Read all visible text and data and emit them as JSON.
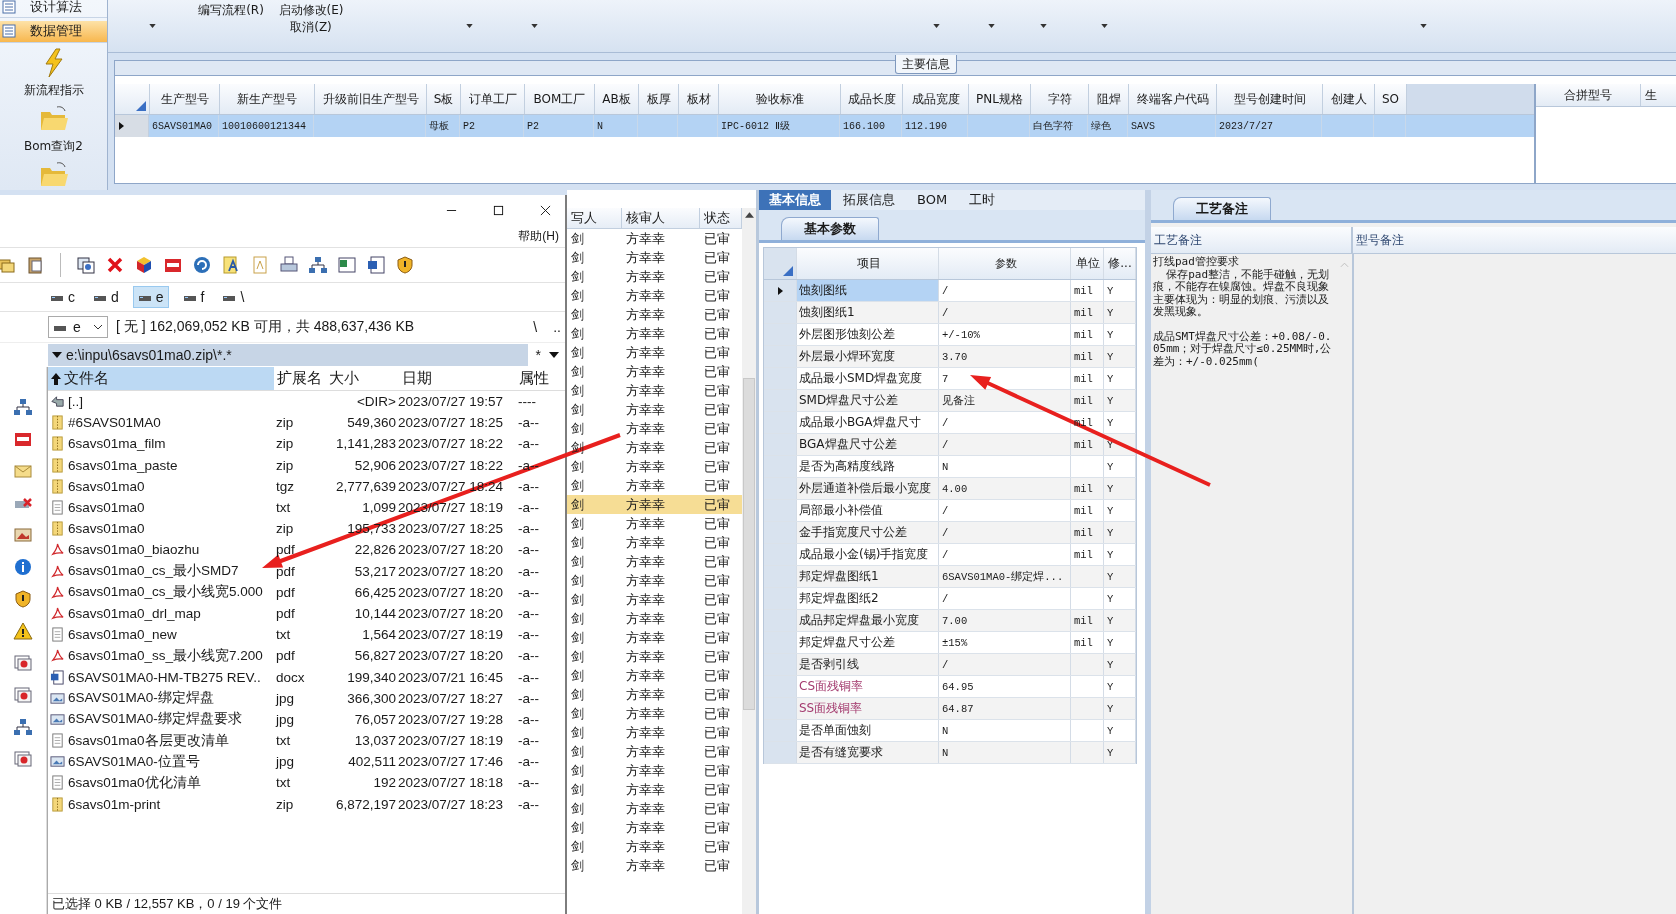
{
  "sidebar": {
    "items": [
      {
        "label": "设计算法",
        "kind": "menu",
        "selected": false
      },
      {
        "label": "数据管理",
        "kind": "menu",
        "selected": true
      },
      {
        "label": "新流程指示",
        "kind": "bolt",
        "selected": false
      },
      {
        "label": "Bom查询2",
        "kind": "folder",
        "selected": false
      },
      {
        "kind": "folder",
        "selected": false
      }
    ]
  },
  "ribbon": {
    "buttons": [
      {
        "label": "编写流程(R)"
      },
      {
        "label": "启动修改(E)"
      },
      {
        "label": "取消(Z)"
      }
    ]
  },
  "main_info": {
    "title": "主要信息",
    "columns": [
      "生产型号",
      "新生产型号",
      "升级前旧生产型号",
      "S板",
      "订单工厂",
      "BOM工厂",
      "AB板",
      "板厚",
      "板材",
      "验收标准",
      "成品长度",
      "成品宽度",
      "PNL规格",
      "字符",
      "阻焊",
      "终端客户代码",
      "型号创建时间",
      "创建人",
      "SO"
    ],
    "rows": [
      {
        "selected": true,
        "cells": [
          "6SAVS01MA0",
          "10010600121344",
          null,
          "母板",
          "P2",
          "P2",
          "N",
          null,
          null,
          "IPC-6012 Ⅱ级",
          "166.100",
          "112.190",
          null,
          "白色字符",
          "绿色",
          "SAVS",
          "2023/7/27",
          null,
          null
        ]
      }
    ],
    "merge_table": {
      "columns": [
        "合拼型号",
        "生"
      ]
    }
  },
  "file_manager": {
    "help_menu": "帮助(H)",
    "drives": [
      {
        "label": "c",
        "selected": false
      },
      {
        "label": "d",
        "selected": false
      },
      {
        "label": "e",
        "selected": true
      },
      {
        "label": "f",
        "selected": false
      },
      {
        "label": "\\",
        "selected": false
      }
    ],
    "drive_combo": "e",
    "free_space": "[ 无 ]  162,069,052 KB 可用，共 488,637,436 KB",
    "root_button": "\\",
    "up_button": "..",
    "path": "e:\\inpu\\6savs01ma0.zip\\*.*",
    "filter_button": "*",
    "columns": [
      {
        "label": "文件名",
        "selected": true
      },
      {
        "label": "扩展名",
        "selected": false
      },
      {
        "label": "大小",
        "selected": false
      },
      {
        "label": "日期",
        "selected": false
      },
      {
        "label": "属性",
        "selected": false
      }
    ],
    "files": [
      {
        "kind": "parent",
        "name": "[..]",
        "size": "<DIR>",
        "date": "2023/07/27 19:57",
        "attr": "----"
      },
      {
        "kind": "archive",
        "name": "#6SAVS01MA0",
        "ext": "zip",
        "size": "549,360",
        "date": "2023/07/27 18:25",
        "attr": "-a--"
      },
      {
        "kind": "archive",
        "name": "6savs01ma_film",
        "ext": "zip",
        "size": "1,141,283",
        "date": "2023/07/27 18:22",
        "attr": "-a--"
      },
      {
        "kind": "archive",
        "name": "6savs01ma_paste",
        "ext": "zip",
        "size": "52,906",
        "date": "2023/07/27 18:22",
        "attr": "-a--"
      },
      {
        "kind": "archive",
        "name": "6savs01ma0",
        "ext": "tgz",
        "size": "2,777,639",
        "date": "2023/07/27 18:24",
        "attr": "-a--"
      },
      {
        "kind": "text",
        "name": "6savs01ma0",
        "ext": "txt",
        "size": "1,099",
        "date": "2023/07/27 18:19",
        "attr": "-a--"
      },
      {
        "kind": "archive",
        "name": "6savs01ma0",
        "ext": "zip",
        "size": "195,733",
        "date": "2023/07/27 18:25",
        "attr": "-a--"
      },
      {
        "kind": "pdf",
        "name": "6savs01ma0_biaozhu",
        "ext": "pdf",
        "size": "22,826",
        "date": "2023/07/27 18:20",
        "attr": "-a--"
      },
      {
        "kind": "pdf",
        "name": "6savs01ma0_cs_最小SMD7",
        "ext": "pdf",
        "size": "53,217",
        "date": "2023/07/27 18:20",
        "attr": "-a--"
      },
      {
        "kind": "pdf",
        "name": "6savs01ma0_cs_最小线宽5.000",
        "ext": "pdf",
        "size": "66,425",
        "date": "2023/07/27 18:20",
        "attr": "-a--"
      },
      {
        "kind": "pdf",
        "name": "6savs01ma0_drl_map",
        "ext": "pdf",
        "size": "10,144",
        "date": "2023/07/27 18:20",
        "attr": "-a--"
      },
      {
        "kind": "text",
        "name": "6savs01ma0_new",
        "ext": "txt",
        "size": "1,564",
        "date": "2023/07/27 18:19",
        "attr": "-a--"
      },
      {
        "kind": "pdf",
        "name": "6savs01ma0_ss_最小线宽7.200",
        "ext": "pdf",
        "size": "56,827",
        "date": "2023/07/27 18:20",
        "attr": "-a--"
      },
      {
        "kind": "word",
        "name": "6SAVS01MA0-HM-TB275 REV..",
        "ext": "docx",
        "size": "199,340",
        "date": "2023/07/21 16:45",
        "attr": "-a--"
      },
      {
        "kind": "image",
        "name": "6SAVS01MA0-绑定焊盘",
        "ext": "jpg",
        "size": "366,300",
        "date": "2023/07/27 18:27",
        "attr": "-a--"
      },
      {
        "kind": "image",
        "name": "6SAVS01MA0-绑定焊盘要求",
        "ext": "jpg",
        "size": "76,057",
        "date": "2023/07/27 19:28",
        "attr": "-a--"
      },
      {
        "kind": "text",
        "name": "6savs01ma0各层更改清单",
        "ext": "txt",
        "size": "13,037",
        "date": "2023/07/27 18:19",
        "attr": "-a--"
      },
      {
        "kind": "image",
        "name": "6SAVS01MA0-位置号",
        "ext": "jpg",
        "size": "402,511",
        "date": "2023/07/27 17:46",
        "attr": "-a--"
      },
      {
        "kind": "text",
        "name": "6savs01ma0优化清单",
        "ext": "txt",
        "size": "192",
        "date": "2023/07/27 18:18",
        "attr": "-a--"
      },
      {
        "kind": "archive",
        "name": "6savs01m-print",
        "ext": "zip",
        "size": "6,872,197",
        "date": "2023/07/27 18:23",
        "attr": "-a--"
      }
    ],
    "status": "已选择 0 KB / 12,557 KB，0 / 19 个文件"
  },
  "review_list": {
    "columns": [
      "写人",
      "核审人",
      "状态"
    ],
    "rows": [
      {
        "writer": "剑",
        "reviewer": "方幸幸",
        "status": "已审",
        "selected": false
      },
      {
        "writer": "剑",
        "reviewer": "方幸幸",
        "status": "已审",
        "selected": false
      },
      {
        "writer": "剑",
        "reviewer": "方幸幸",
        "status": "已审",
        "selected": false
      },
      {
        "writer": "剑",
        "reviewer": "方幸幸",
        "status": "已审",
        "selected": false
      },
      {
        "writer": "剑",
        "reviewer": "方幸幸",
        "status": "已审",
        "selected": false
      },
      {
        "writer": "剑",
        "reviewer": "方幸幸",
        "status": "已审",
        "selected": false
      },
      {
        "writer": "剑",
        "reviewer": "方幸幸",
        "status": "已审",
        "selected": false
      },
      {
        "writer": "剑",
        "reviewer": "方幸幸",
        "status": "已审",
        "selected": false
      },
      {
        "writer": "剑",
        "reviewer": "方幸幸",
        "status": "已审",
        "selected": false
      },
      {
        "writer": "剑",
        "reviewer": "方幸幸",
        "status": "已审",
        "selected": false
      },
      {
        "writer": "剑",
        "reviewer": "方幸幸",
        "status": "已审",
        "selected": false
      },
      {
        "writer": "剑",
        "reviewer": "方幸幸",
        "status": "已审",
        "selected": false
      },
      {
        "writer": "剑",
        "reviewer": "方幸幸",
        "status": "已审",
        "selected": false
      },
      {
        "writer": "剑",
        "reviewer": "方幸幸",
        "status": "已审",
        "selected": false
      },
      {
        "writer": "剑",
        "reviewer": "方幸幸",
        "status": "已审",
        "selected": true
      },
      {
        "writer": "剑",
        "reviewer": "方幸幸",
        "status": "已审",
        "selected": false
      },
      {
        "writer": "剑",
        "reviewer": "方幸幸",
        "status": "已审",
        "selected": false
      },
      {
        "writer": "剑",
        "reviewer": "方幸幸",
        "status": "已审",
        "selected": false
      },
      {
        "writer": "剑",
        "reviewer": "方幸幸",
        "status": "已审",
        "selected": false
      },
      {
        "writer": "剑",
        "reviewer": "方幸幸",
        "status": "已审",
        "selected": false
      },
      {
        "writer": "剑",
        "reviewer": "方幸幸",
        "status": "已审",
        "selected": false
      },
      {
        "writer": "剑",
        "reviewer": "方幸幸",
        "status": "已审",
        "selected": false
      },
      {
        "writer": "剑",
        "reviewer": "方幸幸",
        "status": "已审",
        "selected": false
      },
      {
        "writer": "剑",
        "reviewer": "方幸幸",
        "status": "已审",
        "selected": false
      },
      {
        "writer": "剑",
        "reviewer": "方幸幸",
        "status": "已审",
        "selected": false
      },
      {
        "writer": "剑",
        "reviewer": "方幸幸",
        "status": "已审",
        "selected": false
      },
      {
        "writer": "剑",
        "reviewer": "方幸幸",
        "status": "已审",
        "selected": false
      },
      {
        "writer": "剑",
        "reviewer": "方幸幸",
        "status": "已审",
        "selected": false
      },
      {
        "writer": "剑",
        "reviewer": "方幸幸",
        "status": "已审",
        "selected": false
      },
      {
        "writer": "剑",
        "reviewer": "方幸幸",
        "status": "已审",
        "selected": false
      },
      {
        "writer": "剑",
        "reviewer": "方幸幸",
        "status": "已审",
        "selected": false
      },
      {
        "writer": "剑",
        "reviewer": "方幸幸",
        "status": "已审",
        "selected": false
      },
      {
        "writer": "剑",
        "reviewer": "方幸幸",
        "status": "已审",
        "selected": false
      },
      {
        "writer": "剑",
        "reviewer": "方幸幸",
        "status": "已审",
        "selected": false
      }
    ]
  },
  "properties": {
    "tabs": [
      {
        "label": "基本信息",
        "selected": true
      },
      {
        "label": "拓展信息",
        "selected": false
      },
      {
        "label": "BOM",
        "selected": false
      },
      {
        "label": "工时",
        "selected": false
      }
    ],
    "sub_tab": "基本参数",
    "columns": [
      "项目",
      "参数",
      "单位",
      "修..."
    ],
    "rows": [
      {
        "item": "蚀刻图纸",
        "value": "/",
        "unit": "mil",
        "flag": "Y",
        "kind": "normal",
        "selected": true
      },
      {
        "item": "蚀刻图纸1",
        "value": "/",
        "unit": "mil",
        "flag": "Y",
        "kind": "normal",
        "selected": false
      },
      {
        "item": "外层图形蚀刻公差",
        "value": "+/-10%",
        "unit": "mil",
        "flag": "Y",
        "kind": "normal",
        "selected": false
      },
      {
        "item": "外层最小焊环宽度",
        "value": "3.70",
        "unit": "mil",
        "flag": "Y",
        "kind": "normal",
        "selected": false
      },
      {
        "item": "成品最小SMD焊盘宽度",
        "value": "7",
        "unit": "mil",
        "flag": "Y",
        "kind": "normal",
        "selected": false
      },
      {
        "item": "SMD焊盘尺寸公差",
        "value": "见备注",
        "unit": "mil",
        "flag": "Y",
        "kind": "normal",
        "selected": false
      },
      {
        "item": "成品最小BGA焊盘尺寸",
        "value": "/",
        "unit": "mil",
        "flag": "Y",
        "kind": "normal",
        "selected": false
      },
      {
        "item": "BGA焊盘尺寸公差",
        "value": "/",
        "unit": "mil",
        "flag": "Y",
        "kind": "normal",
        "selected": false
      },
      {
        "item": "是否为高精度线路",
        "value": "N",
        "flag": "Y",
        "kind": "normal",
        "selected": false
      },
      {
        "item": "外层通道补偿后最小宽度",
        "value": "4.00",
        "unit": "mil",
        "flag": "Y",
        "kind": "normal",
        "selected": false
      },
      {
        "item": "局部最小补偿值",
        "value": "/",
        "unit": "mil",
        "flag": "Y",
        "kind": "normal",
        "selected": false
      },
      {
        "item": "金手指宽度尺寸公差",
        "value": "/",
        "unit": "mil",
        "flag": "Y",
        "kind": "normal",
        "selected": false
      },
      {
        "item": "成品最小金(锡)手指宽度",
        "value": "/",
        "unit": "mil",
        "flag": "Y",
        "kind": "normal",
        "selected": false
      },
      {
        "item": "邦定焊盘图纸1",
        "value": "6SAVS01MA0-绑定焊...",
        "flag": "Y",
        "kind": "normal",
        "selected": false
      },
      {
        "item": "邦定焊盘图纸2",
        "value": "/",
        "flag": "Y",
        "kind": "normal",
        "selected": false
      },
      {
        "item": "成品邦定焊盘最小宽度",
        "value": "7.00",
        "unit": "mil",
        "flag": "Y",
        "kind": "normal",
        "selected": false
      },
      {
        "item": "邦定焊盘尺寸公差",
        "value": "±15%",
        "unit": "mil",
        "flag": "Y",
        "kind": "normal",
        "selected": false
      },
      {
        "item": "是否剥引线",
        "value": "/",
        "flag": "Y",
        "kind": "normal",
        "selected": false
      },
      {
        "item": "CS面残铜率",
        "value": "64.95",
        "flag": "Y",
        "kind": "ratio",
        "selected": false
      },
      {
        "item": "SS面残铜率",
        "value": "64.87",
        "flag": "Y",
        "kind": "ratio",
        "selected": false
      },
      {
        "item": "是否单面蚀刻",
        "value": "N",
        "flag": "Y",
        "kind": "normal",
        "selected": false
      },
      {
        "item": "是否有缝宽要求",
        "value": "N",
        "flag": "Y",
        "kind": "normal",
        "selected": false
      }
    ]
  },
  "remarks": {
    "tab": "工艺备注",
    "columns": [
      "工艺备注",
      "型号备注"
    ],
    "paragraphs": [
      "打线pad管控要求",
      "  保存pad整洁，不能手碰触，无划痕，不能存在镍腐蚀。焊盘不良现象主要体现为：明显的划痕、污渍以及发黑现象。",
      "成品SMT焊盘尺寸公差：+0.08/-0.05mm；对于焊盘尺寸≤0.25MM时,公差为：+/-0.025mm("
    ]
  }
}
